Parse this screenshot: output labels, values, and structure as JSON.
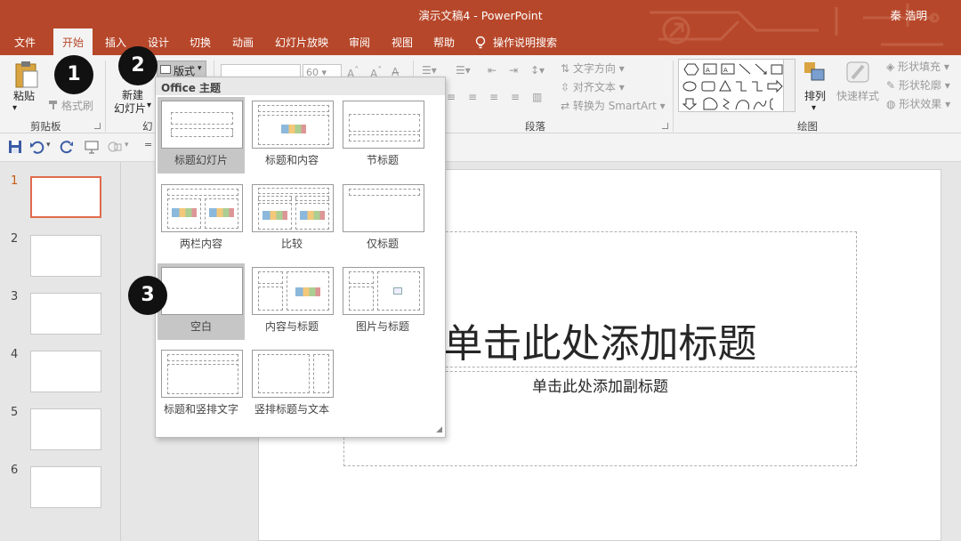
{
  "window": {
    "title": "演示文稿4  -  PowerPoint",
    "user": "秦 浩明"
  },
  "tabs": [
    "文件",
    "开始",
    "插入",
    "设计",
    "切换",
    "动画",
    "幻灯片放映",
    "审阅",
    "视图",
    "帮助"
  ],
  "active_tab": "开始",
  "tell_me": "操作说明搜索",
  "ribbon": {
    "paste_label": "粘贴",
    "format_painter_label": "格式刷",
    "new_slide_label_1": "新建",
    "new_slide_label_2": "幻灯片",
    "layout_label": "版式",
    "font_size_value": "60",
    "text_direction_label": "文字方向",
    "align_text_label": "对齐文本",
    "smartart_label": "转换为 SmartArt",
    "arrange_label": "排列",
    "quick_styles_label": "快速样式",
    "shape_fill_label": "形状填充",
    "shape_outline_label": "形状轮廓",
    "shape_effects_label": "形状效果",
    "groups": {
      "clipboard": "剪贴板",
      "slides": "幻",
      "paragraph": "段落",
      "drawing": "绘图"
    }
  },
  "thumbnails": [
    "1",
    "2",
    "3",
    "4",
    "5",
    "6"
  ],
  "slide": {
    "title_placeholder": "单击此处添加标题",
    "subtitle_placeholder": "单击此处添加副标题"
  },
  "layout_menu": {
    "header": "Office 主题",
    "items": [
      "标题幻灯片",
      "标题和内容",
      "节标题",
      "两栏内容",
      "比较",
      "仅标题",
      "空白",
      "内容与标题",
      "图片与标题",
      "标题和竖排文字",
      "竖排标题与文本"
    ]
  },
  "steps": [
    "1",
    "2",
    "3"
  ]
}
